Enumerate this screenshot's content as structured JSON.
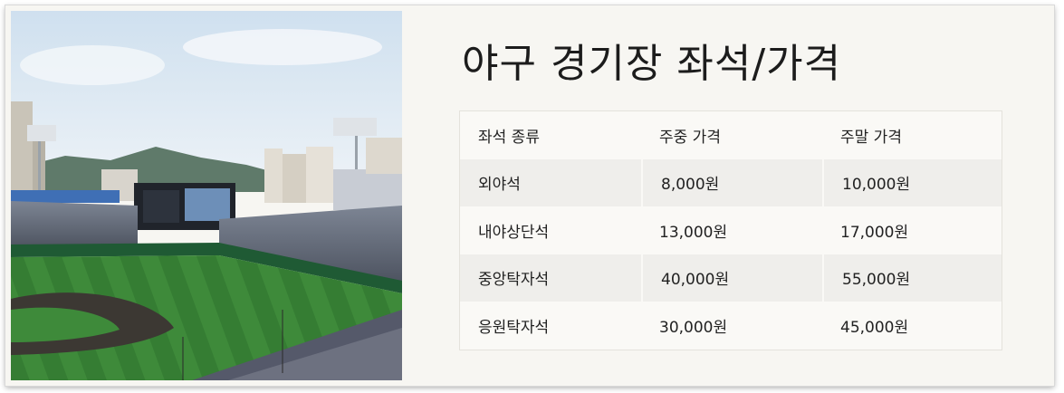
{
  "page": {
    "title": "야구 경기장 좌석/가격"
  },
  "image": {
    "icon": "baseball-stadium-photo"
  },
  "table": {
    "headers": [
      "좌석 종류",
      "주중 가격",
      "주말 가격"
    ],
    "rows": [
      [
        "외야석",
        "8,000원",
        "10,000원"
      ],
      [
        "내야상단석",
        "13,000원",
        "17,000원"
      ],
      [
        "중앙탁자석",
        "40,000원",
        "55,000원"
      ],
      [
        "응원탁자석",
        "30,000원",
        "45,000원"
      ]
    ]
  },
  "colors": {
    "panel_background": "#f7f6f2",
    "alt_row": "#efeeeb",
    "text": "#1c1c1c"
  }
}
